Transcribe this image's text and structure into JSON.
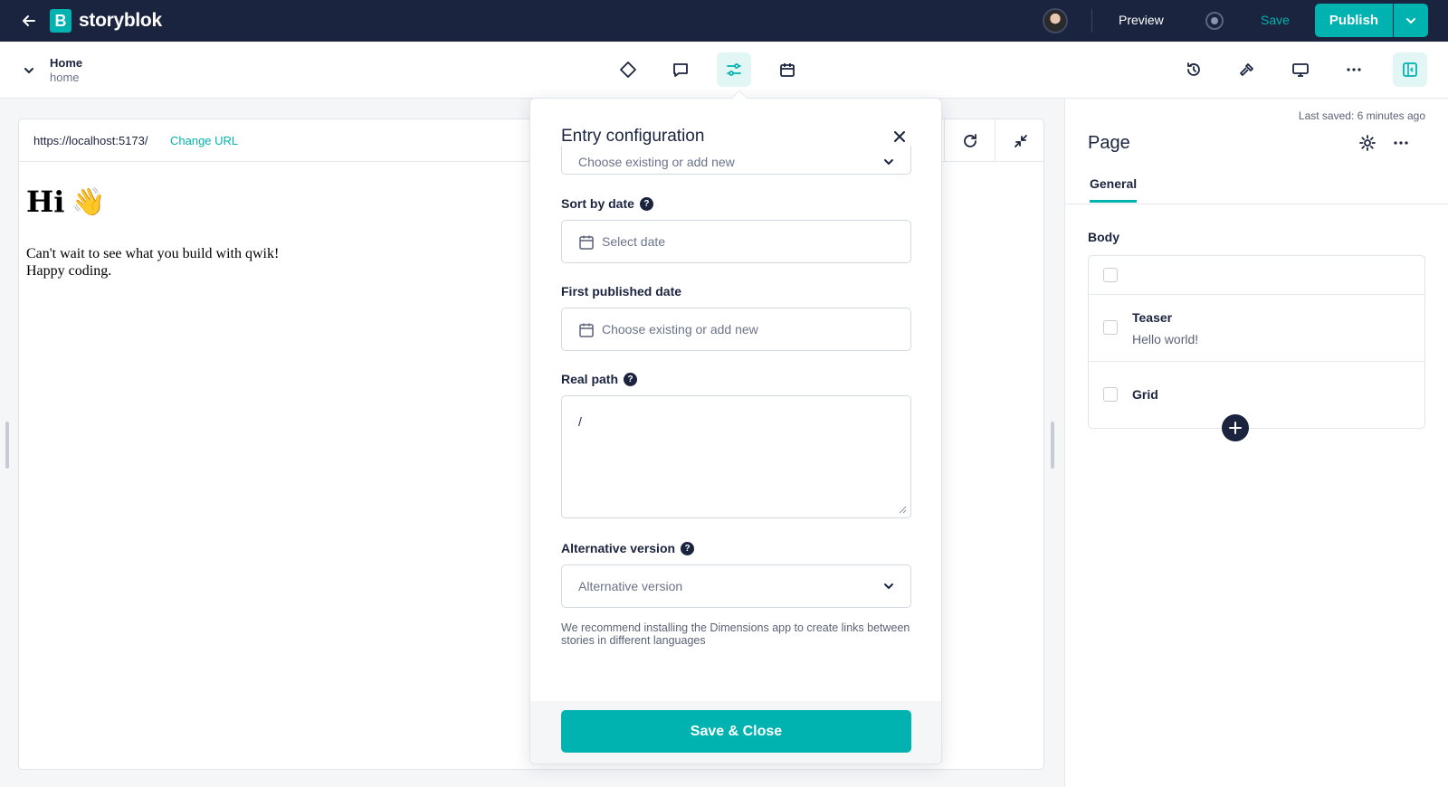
{
  "app": {
    "brand": "storyblok",
    "logo_letter": "B",
    "preview_label": "Preview",
    "save_label": "Save",
    "publish_label": "Publish"
  },
  "story": {
    "title": "Home",
    "slug": "home"
  },
  "preview": {
    "url": "https://localhost:5173/",
    "change_url_label": "Change URL",
    "heading": "Hi",
    "heading_emoji": "👋",
    "text_line1": "Can't wait to see what you build with qwik!",
    "text_line2": "Happy coding."
  },
  "modal": {
    "title": "Entry configuration",
    "partial_select_text": "Choose existing or add new",
    "sort_by_date_label": "Sort by date",
    "sort_by_date_placeholder": "Select date",
    "first_published_label": "First published date",
    "first_published_placeholder": "Choose existing or add new",
    "real_path_label": "Real path",
    "real_path_value": "/",
    "alt_version_label": "Alternative version",
    "alt_version_placeholder": "Alternative version",
    "hint": "We recommend installing the Dimensions app to create links between stories in different languages",
    "save_close_label": "Save & Close"
  },
  "sidebar": {
    "last_saved": "Last saved: 6 minutes ago",
    "title": "Page",
    "tab_general": "General",
    "body_label": "Body",
    "blocks": [
      {
        "name": "",
        "sub": ""
      },
      {
        "name": "Teaser",
        "sub": "Hello world!"
      },
      {
        "name": "Grid",
        "sub": ""
      }
    ]
  },
  "colors": {
    "accent": "#00b3b0",
    "navy": "#1b243f"
  }
}
